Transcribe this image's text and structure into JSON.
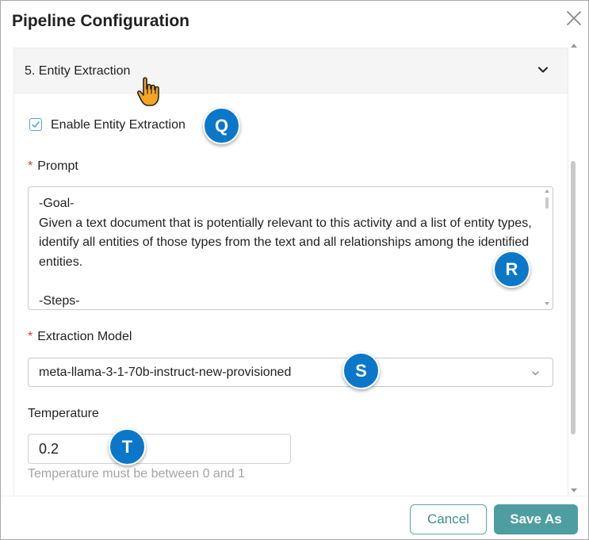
{
  "dialog": {
    "title": "Pipeline Configuration",
    "close_icon": "close-icon"
  },
  "section": {
    "header_label": "5. Entity Extraction",
    "chevron_icon": "chevron-down-icon",
    "enable_checkbox": {
      "label": "Enable Entity Extraction",
      "checked": true
    },
    "prompt": {
      "required_mark": "*",
      "label": "Prompt",
      "value": "-Goal-\nGiven a text document that is potentially relevant to this activity and a list of entity types, identify all entities of those types from the text and all relationships among the identified entities.\n\n-Steps-"
    },
    "extraction_model": {
      "required_mark": "*",
      "label": "Extraction Model",
      "selected": "meta-llama-3-1-70b-instruct-new-provisioned"
    },
    "temperature": {
      "label": "Temperature",
      "value": "0.2",
      "hint": "Temperature must be between 0 and 1"
    }
  },
  "markers": [
    "Q",
    "R",
    "S",
    "T"
  ],
  "footer": {
    "cancel_label": "Cancel",
    "save_label": "Save As"
  },
  "colors": {
    "accent": "#4e9ea1",
    "marker": "#0b77c9",
    "required": "#d9363e",
    "checkbox": "#4aa3d8"
  }
}
